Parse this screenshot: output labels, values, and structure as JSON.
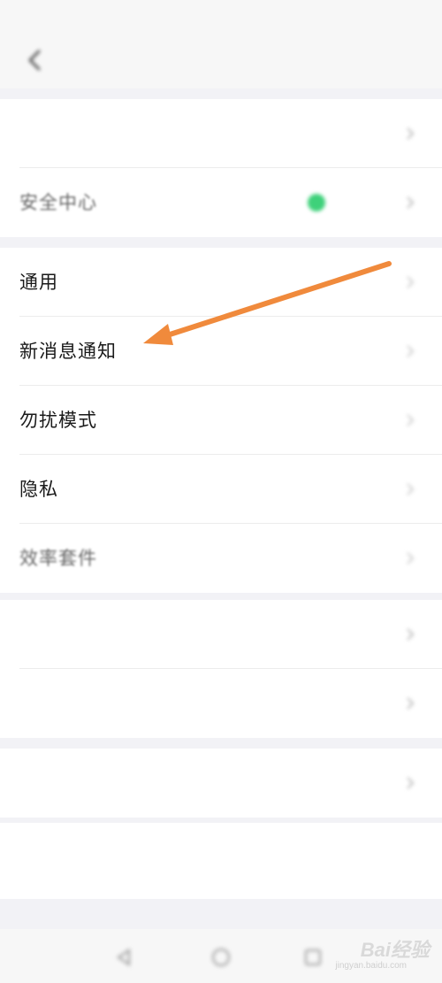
{
  "status_bar": {
    "left_text": "",
    "right_text": ""
  },
  "nav": {
    "title": ""
  },
  "group1": {
    "items": [
      {
        "label": ""
      },
      {
        "label": "安全中心",
        "status": ""
      }
    ]
  },
  "group2": {
    "items": [
      {
        "label": "通用"
      },
      {
        "label": "新消息通知"
      },
      {
        "label": "勿扰模式"
      },
      {
        "label": "隐私"
      },
      {
        "label": "效率套件"
      }
    ]
  },
  "group3": {
    "items": [
      {
        "label": ""
      },
      {
        "label": "",
        "version": ""
      }
    ]
  },
  "group4": {
    "items": [
      {
        "label": ""
      }
    ]
  },
  "logout": {
    "label": ""
  },
  "watermark": {
    "brand": "Bai经验",
    "url": "jingyan.baidu.com"
  },
  "icons": {
    "back": "chevron-left-icon",
    "chevron": "chevron-right-icon",
    "status_dot": "green-dot-icon",
    "annotation": "orange-arrow-icon"
  },
  "colors": {
    "accent_green": "#3ed17a",
    "annotation_orange": "#f08a3c"
  }
}
